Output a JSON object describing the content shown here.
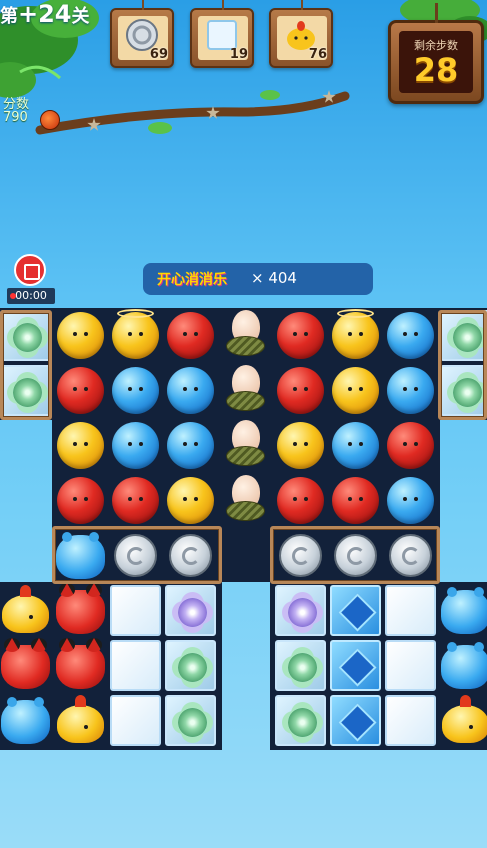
{
  "level": {
    "prefix": "第",
    "number": "+24",
    "suffix": "关"
  },
  "score": {
    "label": "分数",
    "value": "790"
  },
  "goals": [
    {
      "icon": "silver-coin-icon",
      "count": "69"
    },
    {
      "icon": "ice-block-icon",
      "count": "19"
    },
    {
      "icon": "yellow-chick-icon",
      "count": "76"
    }
  ],
  "moves": {
    "label": "剩余步数",
    "value": "28"
  },
  "timer": "00:00",
  "banner": {
    "brand": "开心消消乐",
    "count": "× 404"
  },
  "colors": {
    "red": "#e02a22",
    "blue": "#3aaaf0",
    "yellow": "#f8c41c",
    "board": "#12213a",
    "sky": "#5cc2f4"
  },
  "board": {
    "rows": [
      [
        "flower-green",
        "yellow",
        "yellow-halo",
        "red",
        "egg",
        "red",
        "yellow-halo",
        "blue",
        "flower-green"
      ],
      [
        "flower-green",
        "red",
        "blue",
        "blue",
        "egg",
        "red",
        "yellow",
        "blue",
        "flower-green"
      ],
      [
        "",
        "yellow",
        "blue",
        "blue",
        "egg",
        "yellow",
        "blue",
        "red",
        ""
      ],
      [
        "",
        "red",
        "red",
        "yellow",
        "egg",
        "red",
        "red",
        "blue",
        ""
      ],
      [
        "",
        "jelly",
        "coin",
        "coin",
        "",
        "coin",
        "coin",
        "coin",
        ""
      ],
      [
        "chick",
        "fox",
        "ice",
        "flower-purple",
        "",
        "flower-purple",
        "crystal",
        "ice",
        "jelly"
      ],
      [
        "fox",
        "fox",
        "ice",
        "flower-green",
        "",
        "flower-green",
        "crystal",
        "ice",
        "jelly"
      ],
      [
        "jelly",
        "chick",
        "ice",
        "flower-green",
        "",
        "flower-green",
        "crystal",
        "ice",
        "chick"
      ]
    ]
  }
}
